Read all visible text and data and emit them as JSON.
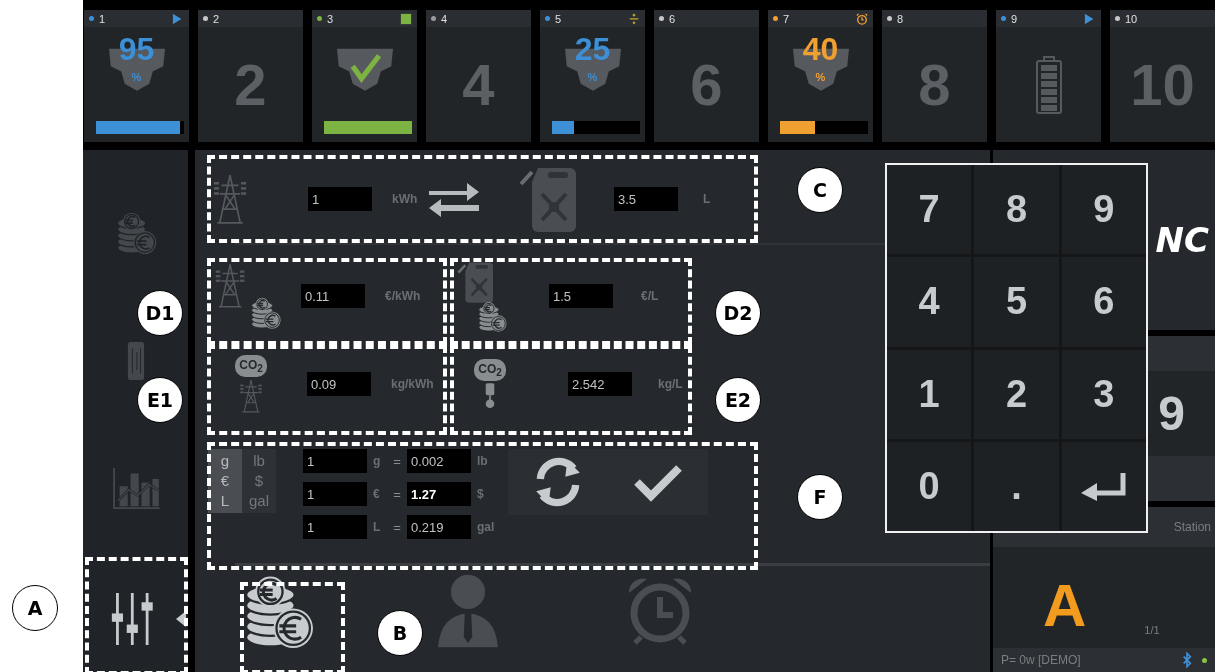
{
  "slots": [
    {
      "kind": "percent",
      "number": "1",
      "color": "#3d8fd6",
      "status": {
        "kind": "play"
      },
      "value": "95",
      "unit": "%",
      "level": 0.95
    },
    {
      "kind": "number",
      "number": "2",
      "color": "#c8c8c8",
      "big": "2"
    },
    {
      "kind": "check",
      "number": "3",
      "color": "#7cb342",
      "status": {
        "kind": "square"
      },
      "level": 1
    },
    {
      "kind": "number",
      "number": "4",
      "color": "#9a9a9a",
      "big": "4"
    },
    {
      "kind": "percent",
      "number": "5",
      "color": "#3d8fd6",
      "status": {
        "kind": "divide"
      },
      "value": "25",
      "unit": "%",
      "level": 0.25
    },
    {
      "kind": "number",
      "number": "6",
      "color": "#c8c8c8",
      "big": "6"
    },
    {
      "kind": "percent",
      "number": "7",
      "color": "#f0a030",
      "status": {
        "kind": "alarm"
      },
      "value": "40",
      "unit": "%",
      "level": 0.4
    },
    {
      "kind": "number",
      "number": "8",
      "color": "#c8c8c8",
      "big": "8"
    },
    {
      "kind": "battery",
      "number": "9",
      "color": "#3d8fd6",
      "status": {
        "kind": "play"
      }
    },
    {
      "kind": "number",
      "number": "10",
      "color": "#c8c8c8",
      "big": "10"
    }
  ],
  "sidebar": {
    "items": [
      {
        "kind": "coins",
        "selected": false
      },
      {
        "kind": "card",
        "selected": false
      },
      {
        "kind": "chart",
        "selected": false
      },
      {
        "kind": "sliders",
        "selected": true
      }
    ]
  },
  "converter": {
    "energy": {
      "value": "1",
      "unit": "kWh"
    },
    "fuel": {
      "value": "3.5",
      "unit": "L"
    }
  },
  "prices": {
    "electricity": {
      "value": "0.11",
      "unit": "€/kWh"
    },
    "fuel": {
      "value": "1.5",
      "unit": "€/L"
    }
  },
  "emissions": {
    "electricity": {
      "co2": "CO$_{2}$",
      "value": "0.09",
      "unit": "kg/kWh"
    },
    "fuel": {
      "co2": "CO$_{2}$",
      "value": "2.542",
      "unit": "kg/L"
    }
  },
  "units": {
    "systems": [
      {
        "labels": [
          "g",
          "€",
          "L"
        ],
        "selected": true
      },
      {
        "labels": [
          "lb",
          "$",
          "gal"
        ],
        "selected": false
      }
    ],
    "rates": [
      {
        "amount": "1",
        "from": "g",
        "equals": "=",
        "value": "0.002",
        "to": "lb",
        "highlighted": false
      },
      {
        "amount": "1",
        "from": "€",
        "equals": "=",
        "value": "1.27",
        "to": "$",
        "highlighted": true
      },
      {
        "amount": "1",
        "from": "L",
        "equals": "=",
        "value": "0.219",
        "to": "gal",
        "highlighted": false
      }
    ]
  },
  "tabs": [
    {
      "kind": "coins",
      "selected": true
    },
    {
      "kind": "person",
      "selected": false
    },
    {
      "kind": "alarm",
      "selected": false
    }
  ],
  "keypad": {
    "keys": [
      {
        "kind": "digit",
        "label": "7"
      },
      {
        "kind": "digit",
        "label": "8"
      },
      {
        "kind": "digit",
        "label": "9"
      },
      {
        "kind": "digit",
        "label": "4"
      },
      {
        "kind": "digit",
        "label": "5"
      },
      {
        "kind": "digit",
        "label": "6"
      },
      {
        "kind": "digit",
        "label": "1"
      },
      {
        "kind": "digit",
        "label": "2"
      },
      {
        "kind": "digit",
        "label": "3"
      },
      {
        "kind": "digit",
        "label": "0"
      },
      {
        "kind": "digit",
        "label": "."
      },
      {
        "kind": "enter"
      }
    ]
  },
  "info": {
    "title": "NC",
    "value": "9",
    "station": "Station",
    "letter": "A",
    "page": "1/1",
    "power": "P= 0w [DEMO]"
  },
  "annotations": [
    {
      "label": "A"
    },
    {
      "label": "B"
    },
    {
      "label": "C"
    },
    {
      "label": "D1"
    },
    {
      "label": "D2"
    },
    {
      "label": "E1"
    },
    {
      "label": "E2"
    },
    {
      "label": "F"
    }
  ]
}
